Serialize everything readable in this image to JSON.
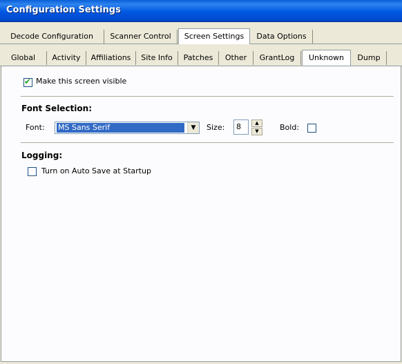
{
  "window": {
    "title": "Configuration Settings"
  },
  "tabs_top": [
    {
      "label": "Decode Configuration"
    },
    {
      "label": "Scanner Control"
    },
    {
      "label": "Screen Settings"
    },
    {
      "label": "Data Options"
    }
  ],
  "tabs_sub": [
    {
      "label": "Global"
    },
    {
      "label": "Activity"
    },
    {
      "label": "Affiliations"
    },
    {
      "label": "Site Info"
    },
    {
      "label": "Patches"
    },
    {
      "label": "Other"
    },
    {
      "label": "GrantLog"
    },
    {
      "label": "Unknown"
    },
    {
      "label": "Dump"
    }
  ],
  "options": {
    "visible_label": "Make this screen visible",
    "visible_checked": true,
    "check_glyph": "✔"
  },
  "font_section": {
    "heading": "Font Selection:",
    "font_label": "Font:",
    "font_value": "MS Sans Serif",
    "size_label": "Size:",
    "size_value": "8",
    "bold_label": "Bold:",
    "bold_checked": false
  },
  "logging": {
    "heading": "Logging:",
    "autosave_label": "Turn on Auto Save at Startup",
    "autosave_checked": false
  },
  "icons": {
    "dropdown": "dropdown-arrow-icon",
    "spin_up": "spin-up-icon",
    "spin_down": "spin-down-icon"
  }
}
